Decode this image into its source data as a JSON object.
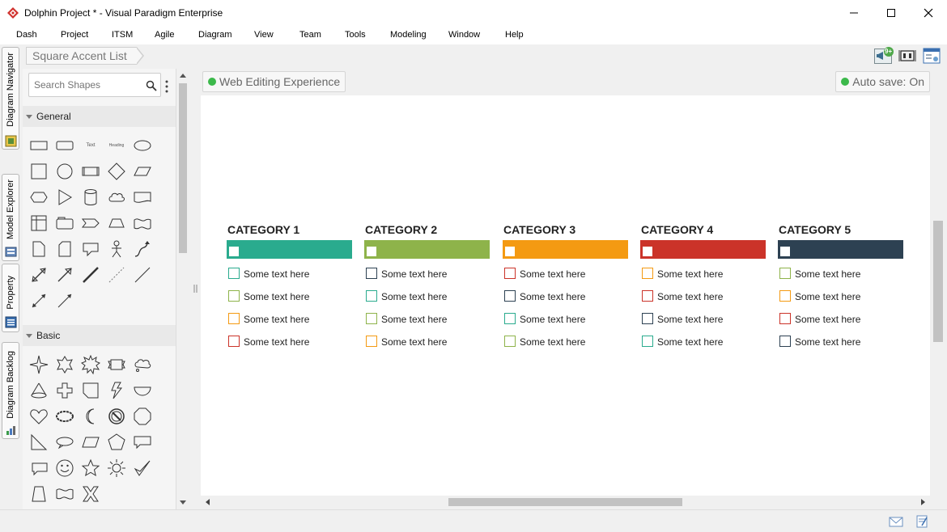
{
  "window": {
    "title": "Dolphin Project * - Visual Paradigm Enterprise"
  },
  "menu": [
    "Dash",
    "Project",
    "ITSM",
    "Agile",
    "Diagram",
    "View",
    "Team",
    "Tools",
    "Modeling",
    "Window",
    "Help"
  ],
  "side_tabs": [
    "Diagram Navigator",
    "Model Explorer",
    "Property",
    "Diagram Backlog"
  ],
  "breadcrumb": {
    "current": "Square Accent List"
  },
  "toolbar": {
    "notification_badge": "9+"
  },
  "shape_panel": {
    "search_placeholder": "Search Shapes",
    "sections": [
      "General",
      "Basic"
    ],
    "general_text_sample": "Text",
    "general_heading_sample": "Heading"
  },
  "status": {
    "web_editing": "Web Editing Experience",
    "auto_save": "Auto save: On"
  },
  "colors": {
    "teal": "#2aab8e",
    "green": "#8eb34a",
    "orange": "#f49a12",
    "red": "#cb3329",
    "navy": "#2d4152"
  },
  "diagram": {
    "categories": [
      {
        "title": "CATEGORY 1",
        "color": "#2aab8e",
        "items": [
          {
            "text": "Some text here",
            "color": "#2aab8e"
          },
          {
            "text": "Some text here",
            "color": "#8eb34a"
          },
          {
            "text": "Some text here",
            "color": "#f49a12"
          },
          {
            "text": "Some text here",
            "color": "#cb3329"
          }
        ]
      },
      {
        "title": "CATEGORY 2",
        "color": "#8eb34a",
        "items": [
          {
            "text": "Some text here",
            "color": "#2d4152"
          },
          {
            "text": "Some text here",
            "color": "#2aab8e"
          },
          {
            "text": "Some text here",
            "color": "#8eb34a"
          },
          {
            "text": "Some text here",
            "color": "#f49a12"
          }
        ]
      },
      {
        "title": "CATEGORY 3",
        "color": "#f49a12",
        "items": [
          {
            "text": "Some text here",
            "color": "#cb3329"
          },
          {
            "text": "Some text here",
            "color": "#2d4152"
          },
          {
            "text": "Some text here",
            "color": "#2aab8e"
          },
          {
            "text": "Some text here",
            "color": "#8eb34a"
          }
        ]
      },
      {
        "title": "CATEGORY 4",
        "color": "#cb3329",
        "items": [
          {
            "text": "Some text here",
            "color": "#f49a12"
          },
          {
            "text": "Some text here",
            "color": "#cb3329"
          },
          {
            "text": "Some text here",
            "color": "#2d4152"
          },
          {
            "text": "Some text here",
            "color": "#2aab8e"
          }
        ]
      },
      {
        "title": "CATEGORY 5",
        "color": "#2d4152",
        "items": [
          {
            "text": "Some text here",
            "color": "#8eb34a"
          },
          {
            "text": "Some text here",
            "color": "#f49a12"
          },
          {
            "text": "Some text here",
            "color": "#cb3329"
          },
          {
            "text": "Some text here",
            "color": "#2d4152"
          }
        ]
      }
    ]
  }
}
